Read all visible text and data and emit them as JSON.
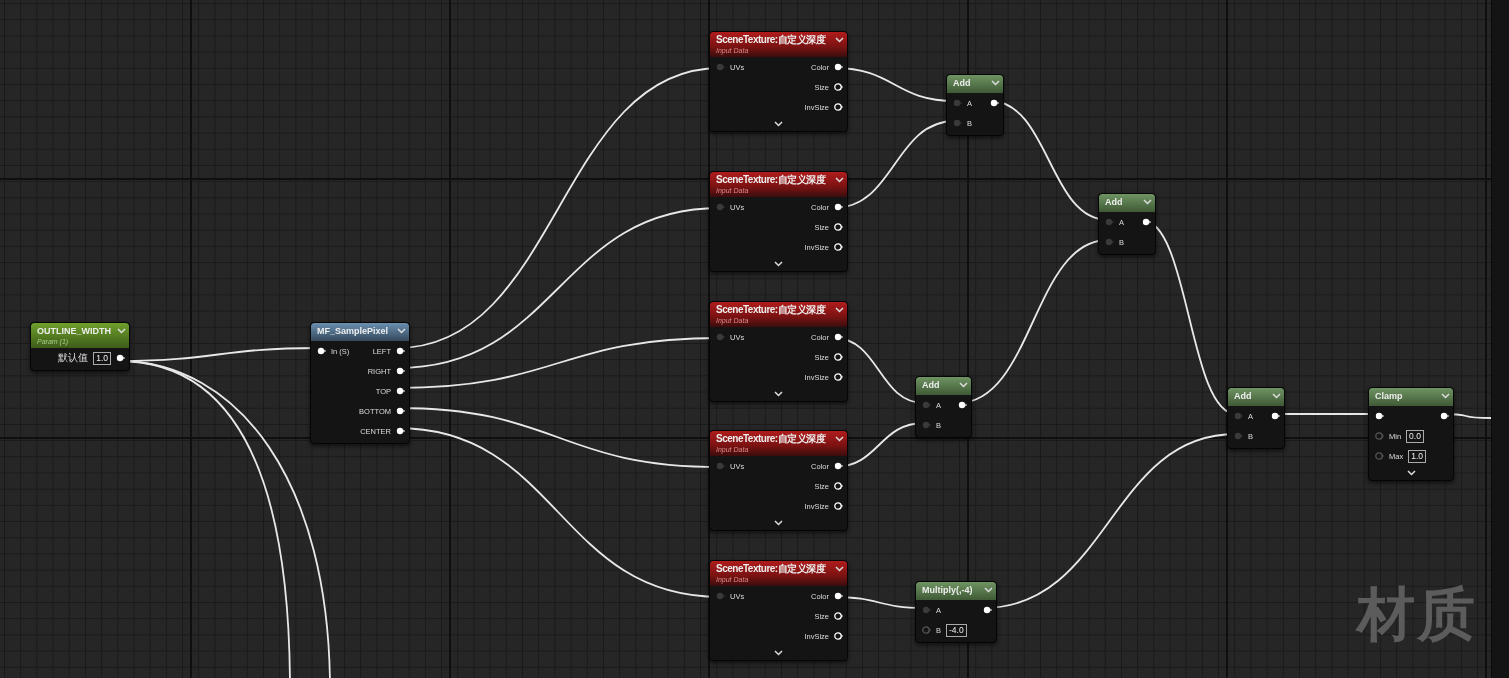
{
  "graph_label": "材质",
  "nodes": [
    {
      "kind": "param",
      "title": "OUTLINE_WIDTH",
      "subtitle": "Param (1)",
      "expandable": false,
      "rows": [
        {
          "out": {
            "label": "默认值",
            "value": "1.0",
            "kind": "solid"
          }
        }
      ]
    },
    {
      "kind": "function",
      "title": "MF_SamplePixel",
      "expandable": false,
      "rows": [
        {
          "in": {
            "label": "In (S)",
            "kind": "solid"
          },
          "out": {
            "label": "LEFT",
            "kind": "solid"
          }
        },
        {
          "out": {
            "label": "RIGHT",
            "kind": "solid"
          }
        },
        {
          "out": {
            "label": "TOP",
            "kind": "solid"
          }
        },
        {
          "out": {
            "label": "BOTTOM",
            "kind": "solid"
          }
        },
        {
          "out": {
            "label": "CENTER",
            "kind": "solid"
          }
        }
      ]
    },
    {
      "kind": "texture",
      "title": "SceneTexture:自定义深度",
      "subtitle": "Input Data",
      "expandable": true,
      "rows": [
        {
          "in": {
            "label": "UVs",
            "kind": "dim"
          },
          "out": {
            "label": "Color",
            "kind": "solid"
          }
        },
        {
          "out": {
            "label": "Size",
            "kind": "hollow"
          }
        },
        {
          "out": {
            "label": "InvSize",
            "kind": "hollow"
          }
        }
      ]
    },
    {
      "kind": "texture",
      "title": "SceneTexture:自定义深度",
      "subtitle": "Input Data",
      "expandable": true,
      "rows": [
        {
          "in": {
            "label": "UVs",
            "kind": "dim"
          },
          "out": {
            "label": "Color",
            "kind": "solid"
          }
        },
        {
          "out": {
            "label": "Size",
            "kind": "hollow"
          }
        },
        {
          "out": {
            "label": "InvSize",
            "kind": "hollow"
          }
        }
      ]
    },
    {
      "kind": "texture",
      "title": "SceneTexture:自定义深度",
      "subtitle": "Input Data",
      "expandable": true,
      "rows": [
        {
          "in": {
            "label": "UVs",
            "kind": "dim"
          },
          "out": {
            "label": "Color",
            "kind": "solid"
          }
        },
        {
          "out": {
            "label": "Size",
            "kind": "hollow"
          }
        },
        {
          "out": {
            "label": "InvSize",
            "kind": "hollow"
          }
        }
      ]
    },
    {
      "kind": "texture",
      "title": "SceneTexture:自定义深度",
      "subtitle": "Input Data",
      "expandable": true,
      "rows": [
        {
          "in": {
            "label": "UVs",
            "kind": "dim"
          },
          "out": {
            "label": "Color",
            "kind": "solid"
          }
        },
        {
          "out": {
            "label": "Size",
            "kind": "hollow"
          }
        },
        {
          "out": {
            "label": "InvSize",
            "kind": "hollow"
          }
        }
      ]
    },
    {
      "kind": "texture",
      "title": "SceneTexture:自定义深度",
      "subtitle": "Input Data",
      "expandable": true,
      "rows": [
        {
          "in": {
            "label": "UVs",
            "kind": "dim"
          },
          "out": {
            "label": "Color",
            "kind": "solid"
          }
        },
        {
          "out": {
            "label": "Size",
            "kind": "hollow"
          }
        },
        {
          "out": {
            "label": "InvSize",
            "kind": "hollow"
          }
        }
      ]
    },
    {
      "kind": "math",
      "title": "Add",
      "expandable": false,
      "rows": [
        {
          "in": {
            "label": "A",
            "kind": "dim"
          },
          "out": {
            "kind": "solid"
          }
        },
        {
          "in": {
            "label": "B",
            "kind": "dim"
          }
        }
      ]
    },
    {
      "kind": "math",
      "title": "Add",
      "expandable": false,
      "rows": [
        {
          "in": {
            "label": "A",
            "kind": "dim"
          },
          "out": {
            "kind": "solid"
          }
        },
        {
          "in": {
            "label": "B",
            "kind": "dim"
          }
        }
      ]
    },
    {
      "kind": "math",
      "title": "Add",
      "expandable": false,
      "rows": [
        {
          "in": {
            "label": "A",
            "kind": "dim"
          },
          "out": {
            "kind": "solid"
          }
        },
        {
          "in": {
            "label": "B",
            "kind": "dim"
          }
        }
      ]
    },
    {
      "kind": "math",
      "title": "Add",
      "expandable": false,
      "rows": [
        {
          "in": {
            "label": "A",
            "kind": "dim"
          },
          "out": {
            "kind": "solid"
          }
        },
        {
          "in": {
            "label": "B",
            "kind": "dim"
          }
        }
      ]
    },
    {
      "kind": "math",
      "title": "Multiply(,-4)",
      "expandable": false,
      "rows": [
        {
          "in": {
            "label": "A",
            "kind": "dim"
          },
          "out": {
            "kind": "solid"
          }
        },
        {
          "in": {
            "label": "B",
            "value": "-4.0",
            "kind": "hollow"
          }
        }
      ]
    },
    {
      "kind": "math",
      "title": "Clamp",
      "expandable": true,
      "rows": [
        {
          "in": {
            "kind": "solid"
          },
          "out": {
            "kind": "solid"
          }
        },
        {
          "in": {
            "label": "Min",
            "value": "0.0",
            "kind": "hollow"
          }
        },
        {
          "in": {
            "label": "Max",
            "value": "1.0",
            "kind": "hollow"
          }
        }
      ]
    }
  ]
}
